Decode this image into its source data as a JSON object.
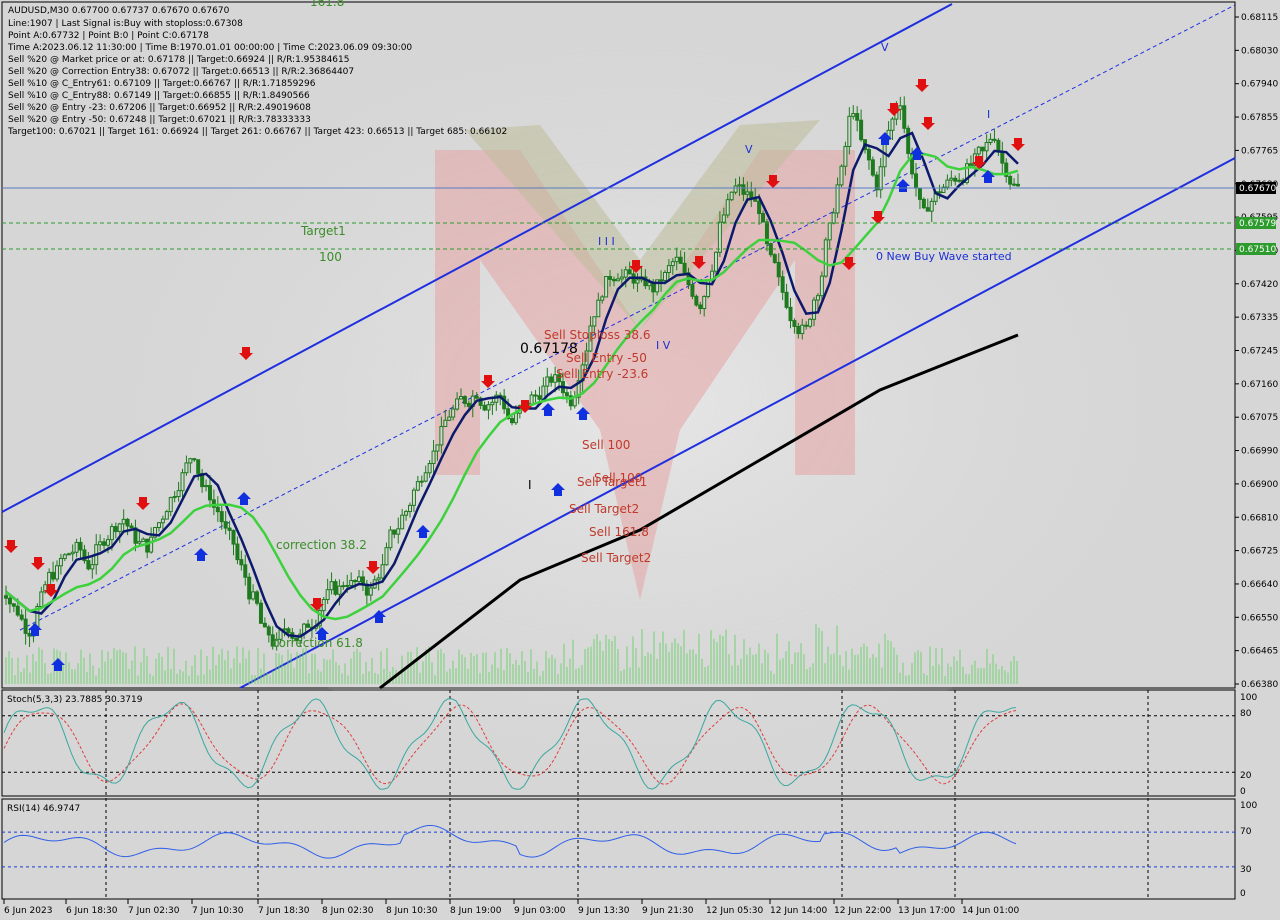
{
  "header": {
    "line1": "AUDUSD,M30  0.67700 0.67737 0.67670 0.67670",
    "line2": "Line:1907 | Last Signal is:Buy with stoploss:0.67308",
    "line3": "Point A:0.67732 | Point B:0 | Point C:0.67178",
    "line4": "Time A:2023.06.12 11:30:00 | Time B:1970.01.01 00:00:00 | Time C:2023.06.09 09:30:00",
    "line5": "Sell %20 @ Market price or at: 0.67178 || Target:0.66924 || R/R:1.95384615",
    "line6": "Sell %20 @ Correction Entry38: 0.67072 || Target:0.66513 || R/R:2.36864407",
    "line7": "Sell %10 @ C_Entry61: 0.67109 || Target:0.66767 || R/R:1.71859296",
    "line8": "Sell %10 @ C_Entry88: 0.67149 || Target:0.66855 || R/R:1.8490566",
    "line9": "Sell %20 @ Entry -23: 0.67206 || Target:0.66952 || R/R:2.49019608",
    "line10": "Sell %20 @ Entry -50: 0.67248 || Target:0.67021 || R/R:3.78333333",
    "line11": "Target100: 0.67021 || Target 161: 0.66924 || Target 261: 0.66767 || Target 423: 0.66513 || Target 685: 0.66102"
  },
  "price_axis": {
    "ticks": [
      "0.68115",
      "0.68030",
      "0.67940",
      "0.67855",
      "0.67765",
      "0.67680",
      "0.67595",
      "0.67510",
      "0.67420",
      "0.67335",
      "0.67245",
      "0.67160",
      "0.67075",
      "0.66990",
      "0.66900",
      "0.66810",
      "0.66725",
      "0.66640",
      "0.66550",
      "0.66465",
      "0.66380"
    ],
    "current_price": "0.67670",
    "level_a": "0.67579",
    "level_b": "0.67510"
  },
  "time_axis": {
    "labels": [
      "6 Jun 2023",
      "6 Jun 18:30",
      "7 Jun 02:30",
      "7 Jun 10:30",
      "7 Jun 18:30",
      "8 Jun 02:30",
      "8 Jun 10:30",
      "8 Jun 19:00",
      "9 Jun 03:00",
      "9 Jun 13:30",
      "9 Jun 21:30",
      "12 Jun 05:30",
      "12 Jun 14:00",
      "12 Jun 22:00",
      "13 Jun 17:00",
      "14 Jun 01:00"
    ]
  },
  "annotations": {
    "target1": "Target1",
    "hundred": "100",
    "new_wave": "0 New Buy Wave started",
    "sell_stoploss": "Sell Stoploss  38.6",
    "sell_entry_50": "Sell Entry -50",
    "sell_entry_236": "Sell Entry -23.6",
    "price_tag": "0.67178",
    "sell_100": "Sell 100",
    "sell_target1": "Sell Target1",
    "sell_target1_b": "Sell 100",
    "sell_target2": "Sell Target2",
    "sell_1618": "Sell 161.8",
    "sell_target2_b": "Sell Target2",
    "correction382": "correction 38.2",
    "correction618": "correction 61.8",
    "wave_v": "V",
    "wave_iii": "I I I",
    "wave_iv": "I V",
    "wave_i": "I",
    "wave_v2": "V",
    "wave_i2": "I",
    "wave_top_left": "161.8"
  },
  "stoch": {
    "label": "Stoch(5,3,3) 23.7885 30.3719",
    "levels": [
      "100",
      "80",
      "20",
      "0"
    ]
  },
  "rsi": {
    "label": "RSI(14) 46.9747",
    "levels": [
      "100",
      "70",
      "30",
      "0"
    ]
  },
  "colors": {
    "background": "#d6d6d6",
    "candle": "#1f7a1f",
    "ma_fast": "#0d1a6b",
    "ma_mid": "#3dd13d",
    "ma_slow": "#000000",
    "channel": "#1f2fe0",
    "stoch_main": "#3aa8a0",
    "stoch_signal": "#e04040",
    "rsi": "#2f5fe8"
  },
  "chart_data": {
    "type": "candlestick",
    "symbol": "AUDUSD",
    "timeframe": "M30",
    "title": "AUDUSD,M30",
    "ylim": [
      0.6638,
      0.6816
    ],
    "current_price": 0.6767,
    "close_path": [
      0.6662,
      0.6657,
      0.6652,
      0.666,
      0.6667,
      0.6671,
      0.6673,
      0.6669,
      0.6674,
      0.6678,
      0.6681,
      0.6676,
      0.6674,
      0.668,
      0.6686,
      0.6692,
      0.6698,
      0.6688,
      0.6683,
      0.6676,
      0.6668,
      0.666,
      0.6651,
      0.6648,
      0.6653,
      0.665,
      0.6654,
      0.666,
      0.6663,
      0.6665,
      0.6664,
      0.6662,
      0.6668,
      0.6678,
      0.6683,
      0.669,
      0.6697,
      0.6703,
      0.6709,
      0.6712,
      0.6714,
      0.6711,
      0.6713,
      0.6706,
      0.671,
      0.6713,
      0.6716,
      0.6717,
      0.6712,
      0.6722,
      0.6735,
      0.6742,
      0.6745,
      0.6744,
      0.6742,
      0.6741,
      0.6744,
      0.6748,
      0.6742,
      0.6737,
      0.6747,
      0.676,
      0.6767,
      0.6765,
      0.6762,
      0.6748,
      0.674,
      0.6733,
      0.673,
      0.6741,
      0.6756,
      0.6771,
      0.6788,
      0.6776,
      0.6768,
      0.6782,
      0.679,
      0.6772,
      0.676,
      0.6765,
      0.6768,
      0.677,
      0.6773,
      0.6776,
      0.6781,
      0.6772,
      0.6767
    ],
    "ma_fast_name": "",
    "ma_mid_name": "",
    "ma_slow_name": ""
  }
}
